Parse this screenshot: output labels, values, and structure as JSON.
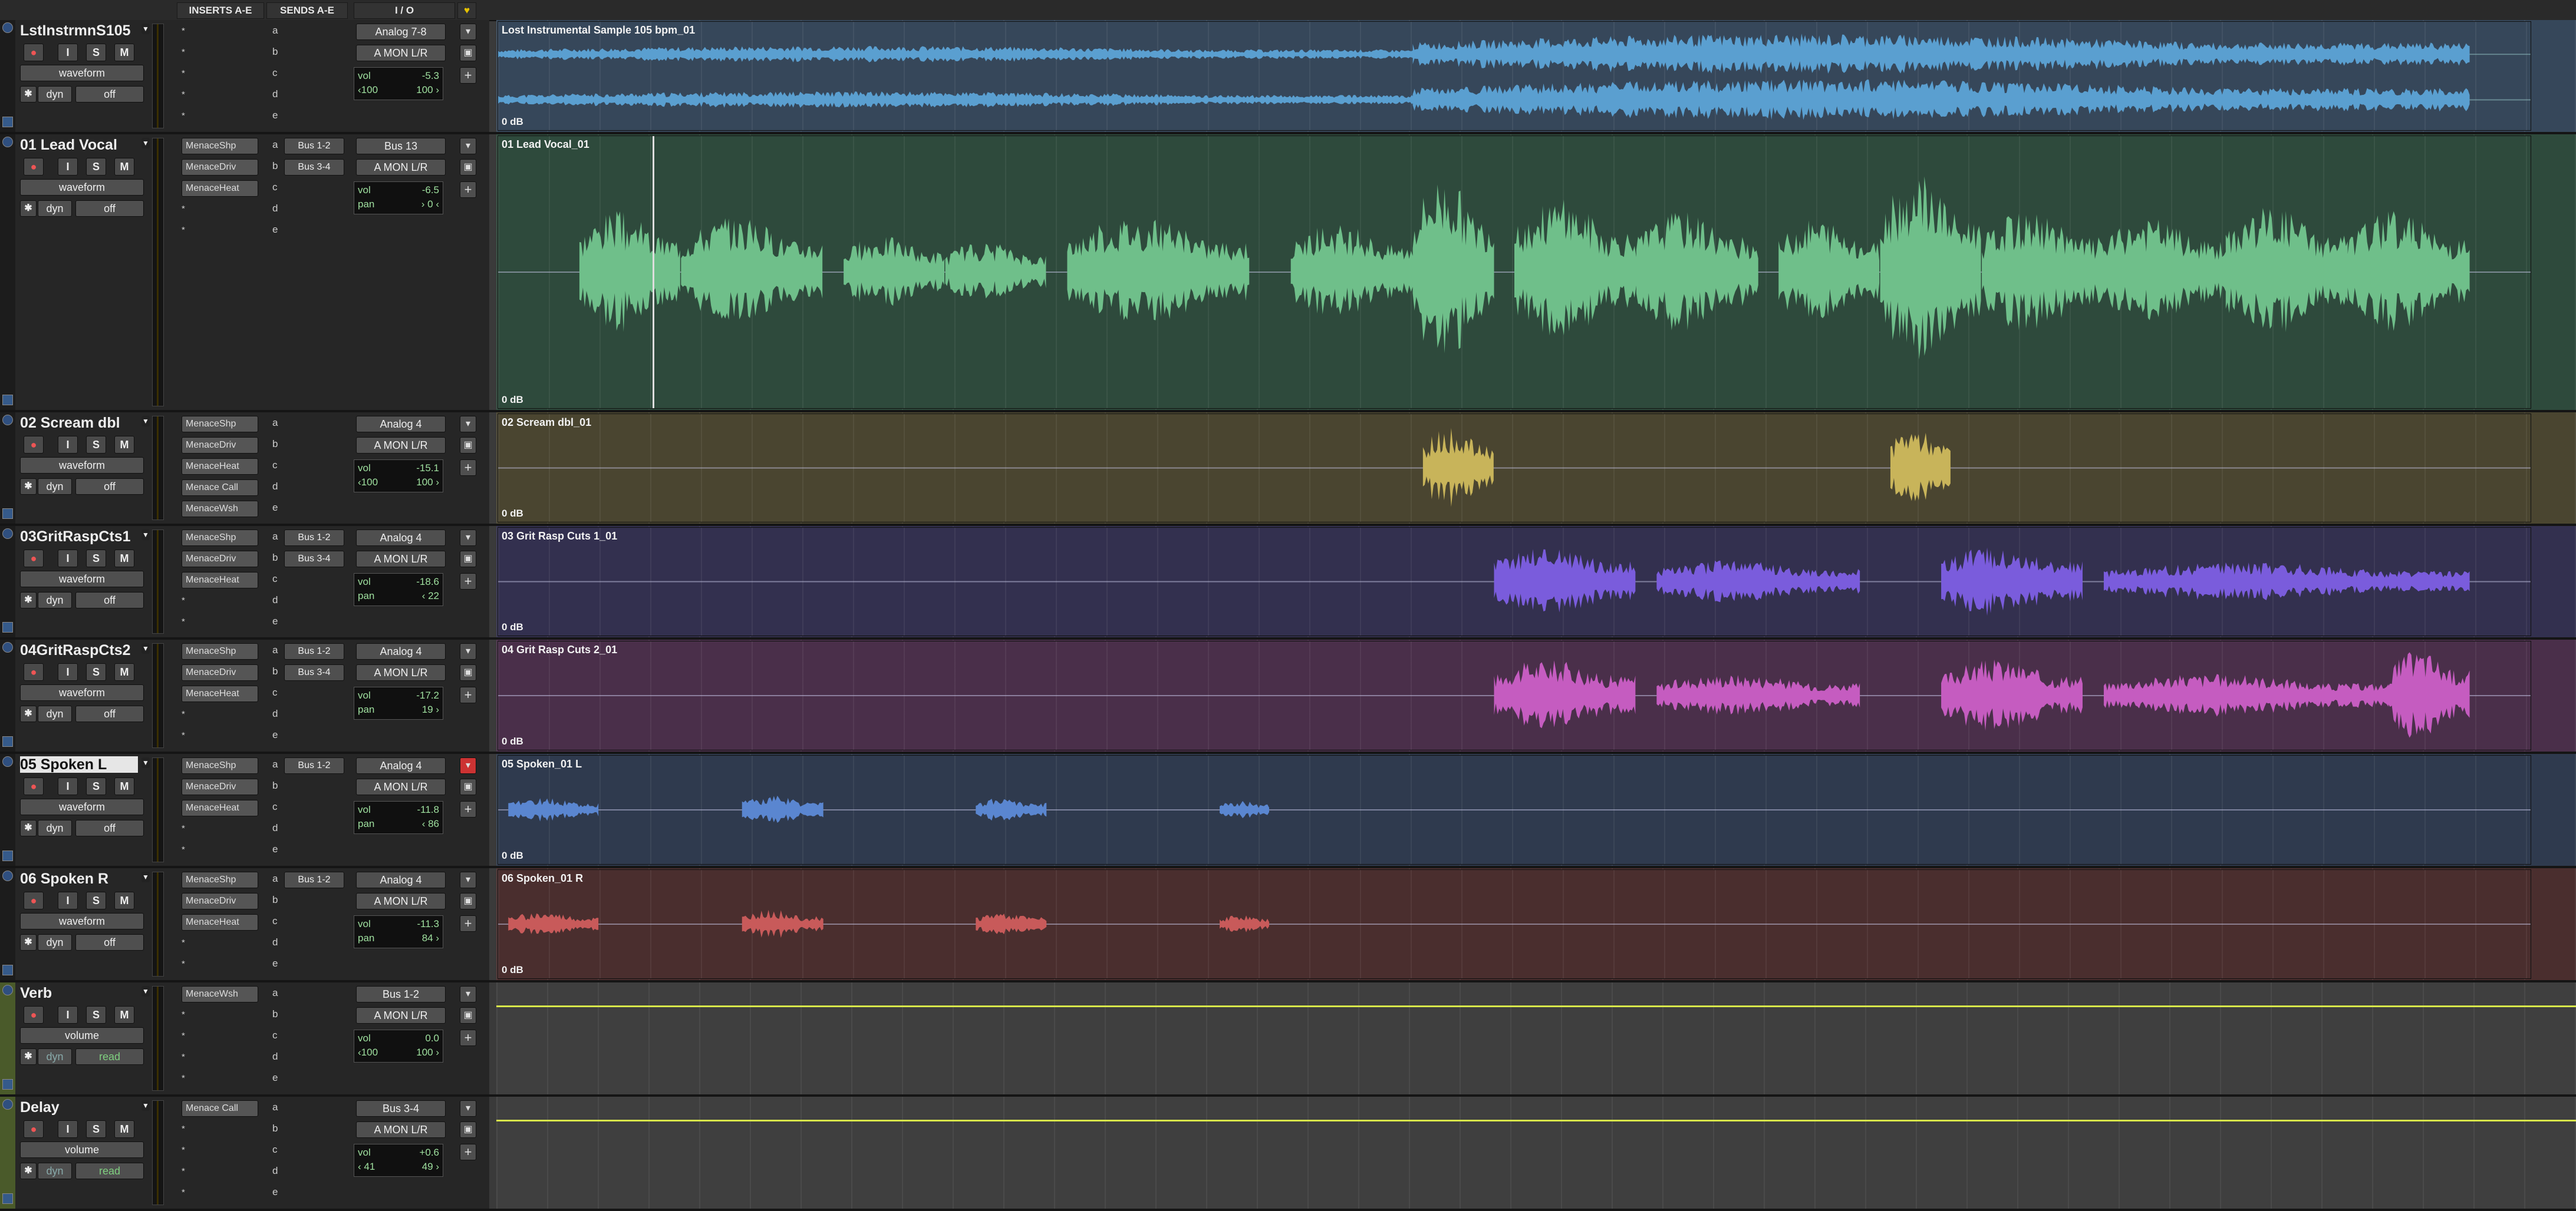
{
  "header": {
    "inserts_label": "INSERTS A-E",
    "sends_label": "SENDS A-E",
    "io_label": "I / O"
  },
  "tracks": [
    {
      "name": "LstInstrmnS105",
      "selected": false,
      "view": "waveform",
      "dyn": "dyn",
      "auto": "off",
      "inserts": [
        "*",
        "*",
        "*",
        "*",
        "*"
      ],
      "sends": [
        {
          "letter": "a",
          "bus": ""
        },
        {
          "letter": "b",
          "bus": ""
        },
        {
          "letter": "c",
          "bus": ""
        },
        {
          "letter": "d",
          "bus": ""
        },
        {
          "letter": "e",
          "bus": ""
        }
      ],
      "input": "Analog 7-8",
      "output": "A MON L/R",
      "vol_label": "vol",
      "vol": "-5.3",
      "pan_left": "‹100",
      "pan_right": "100 ›",
      "clip_name": "Lost Instrumental Sample 105 bpm_01",
      "clip_gain": "0 dB",
      "color": "#5a9fd0",
      "lane_bg": "#36475a"
    },
    {
      "name": "01 Lead Vocal",
      "selected": false,
      "view": "waveform",
      "dyn": "dyn",
      "auto": "off",
      "inserts": [
        "MenaceShp",
        "MenaceDriv",
        "MenaceHeat",
        "*",
        "*"
      ],
      "sends": [
        {
          "letter": "a",
          "bus": "Bus 1-2"
        },
        {
          "letter": "b",
          "bus": "Bus 3-4"
        },
        {
          "letter": "c",
          "bus": ""
        },
        {
          "letter": "d",
          "bus": ""
        },
        {
          "letter": "e",
          "bus": ""
        }
      ],
      "input": "Bus 13",
      "output": "A MON L/R",
      "vol_label": "vol",
      "vol": "-6.5",
      "pan_label": "pan",
      "pan": "› 0 ‹",
      "clip_name": "01 Lead Vocal_01",
      "clip_gain": "0 dB",
      "color": "#6fbf8a",
      "lane_bg": "#2e4a3c"
    },
    {
      "name": "02 Scream dbl",
      "selected": false,
      "view": "waveform",
      "dyn": "dyn",
      "auto": "off",
      "inserts": [
        "MenaceShp",
        "MenaceDriv",
        "MenaceHeat",
        "Menace Call",
        "MenaceWsh"
      ],
      "sends": [
        {
          "letter": "a",
          "bus": ""
        },
        {
          "letter": "b",
          "bus": ""
        },
        {
          "letter": "c",
          "bus": ""
        },
        {
          "letter": "d",
          "bus": ""
        },
        {
          "letter": "e",
          "bus": ""
        }
      ],
      "input": "Analog 4",
      "output": "A MON L/R",
      "vol_label": "vol",
      "vol": "-15.1",
      "pan_left": "‹100",
      "pan_right": "100 ›",
      "clip_name": "02 Scream dbl_01",
      "clip_gain": "0 dB",
      "color": "#c8b45a",
      "lane_bg": "#4a4530"
    },
    {
      "name": "03GritRaspCts1",
      "selected": false,
      "view": "waveform",
      "dyn": "dyn",
      "auto": "off",
      "inserts": [
        "MenaceShp",
        "MenaceDriv",
        "MenaceHeat",
        "*",
        "*"
      ],
      "sends": [
        {
          "letter": "a",
          "bus": "Bus 1-2"
        },
        {
          "letter": "b",
          "bus": "Bus 3-4"
        },
        {
          "letter": "c",
          "bus": ""
        },
        {
          "letter": "d",
          "bus": ""
        },
        {
          "letter": "e",
          "bus": ""
        }
      ],
      "input": "Analog 4",
      "output": "A MON L/R",
      "vol_label": "vol",
      "vol": "-18.6",
      "pan_label": "pan",
      "pan": "‹ 22",
      "clip_name": "03 Grit Rasp Cuts 1_01",
      "clip_gain": "0 dB",
      "color": "#7a5cdc",
      "lane_bg": "#33304f"
    },
    {
      "name": "04GritRaspCts2",
      "selected": false,
      "view": "waveform",
      "dyn": "dyn",
      "auto": "off",
      "inserts": [
        "MenaceShp",
        "MenaceDriv",
        "MenaceHeat",
        "*",
        "*"
      ],
      "sends": [
        {
          "letter": "a",
          "bus": "Bus 1-2"
        },
        {
          "letter": "b",
          "bus": "Bus 3-4"
        },
        {
          "letter": "c",
          "bus": ""
        },
        {
          "letter": "d",
          "bus": ""
        },
        {
          "letter": "e",
          "bus": ""
        }
      ],
      "input": "Analog 4",
      "output": "A MON L/R",
      "vol_label": "vol",
      "vol": "-17.2",
      "pan_label": "pan",
      "pan": "19 ›",
      "clip_name": "04 Grit Rasp Cuts 2_01",
      "clip_gain": "0 dB",
      "color": "#c55cc0",
      "lane_bg": "#4a2f4a"
    },
    {
      "name": "05 Spoken L",
      "selected": true,
      "view": "waveform",
      "dyn": "dyn",
      "auto": "off",
      "inserts": [
        "MenaceShp",
        "MenaceDriv",
        "MenaceHeat",
        "*",
        "*"
      ],
      "sends": [
        {
          "letter": "a",
          "bus": "Bus 1-2"
        },
        {
          "letter": "b",
          "bus": ""
        },
        {
          "letter": "c",
          "bus": ""
        },
        {
          "letter": "d",
          "bus": ""
        },
        {
          "letter": "e",
          "bus": ""
        }
      ],
      "input": "Analog 4",
      "output": "A MON L/R",
      "vol_label": "vol",
      "vol": "-11.8",
      "pan_label": "pan",
      "pan": "‹ 86",
      "clip_name": "05 Spoken_01 L",
      "clip_gain": "0 dB",
      "color": "#5a86d0",
      "lane_bg": "#2f3a4e"
    },
    {
      "name": "06 Spoken R",
      "selected": false,
      "view": "waveform",
      "dyn": "dyn",
      "auto": "off",
      "inserts": [
        "MenaceShp",
        "MenaceDriv",
        "MenaceHeat",
        "*",
        "*"
      ],
      "sends": [
        {
          "letter": "a",
          "bus": "Bus 1-2"
        },
        {
          "letter": "b",
          "bus": ""
        },
        {
          "letter": "c",
          "bus": ""
        },
        {
          "letter": "d",
          "bus": ""
        },
        {
          "letter": "e",
          "bus": ""
        }
      ],
      "input": "Analog 4",
      "output": "A MON L/R",
      "vol_label": "vol",
      "vol": "-11.3",
      "pan_label": "pan",
      "pan": "84 ›",
      "clip_name": "06 Spoken_01 R",
      "clip_gain": "0 dB",
      "color": "#c85a5a",
      "lane_bg": "#4a2e2e"
    },
    {
      "name": "Verb",
      "selected": false,
      "view": "volume",
      "dyn": "dyn",
      "auto": "read",
      "inserts": [
        "MenaceWsh",
        "*",
        "*",
        "*",
        "*"
      ],
      "sends": [
        {
          "letter": "a",
          "bus": ""
        },
        {
          "letter": "b",
          "bus": ""
        },
        {
          "letter": "c",
          "bus": ""
        },
        {
          "letter": "d",
          "bus": ""
        },
        {
          "letter": "e",
          "bus": ""
        }
      ],
      "input": "Bus 1-2",
      "output": "A MON L/R",
      "vol_label": "vol",
      "vol": "0.0",
      "pan_left": "‹100",
      "pan_right": "100 ›",
      "clip_name": "",
      "clip_gain": "",
      "color": "#d8e84a",
      "lane_bg": "#3f3f3f"
    },
    {
      "name": "Delay",
      "selected": false,
      "view": "volume",
      "dyn": "dyn",
      "auto": "read",
      "inserts": [
        "Menace Call",
        "*",
        "*",
        "*",
        "*"
      ],
      "sends": [
        {
          "letter": "a",
          "bus": ""
        },
        {
          "letter": "b",
          "bus": ""
        },
        {
          "letter": "c",
          "bus": ""
        },
        {
          "letter": "d",
          "bus": ""
        },
        {
          "letter": "e",
          "bus": ""
        }
      ],
      "input": "Bus 3-4",
      "output": "A MON L/R",
      "vol_label": "vol",
      "vol": "+0.6",
      "pan_left": "‹ 41",
      "pan_right": "49 ›",
      "clip_name": "",
      "clip_gain": "",
      "color": "#d8e84a",
      "lane_bg": "#3f3f3f"
    }
  ],
  "buttons": {
    "rec": "●",
    "input": "I",
    "solo": "S",
    "mute": "M",
    "add": "+"
  }
}
